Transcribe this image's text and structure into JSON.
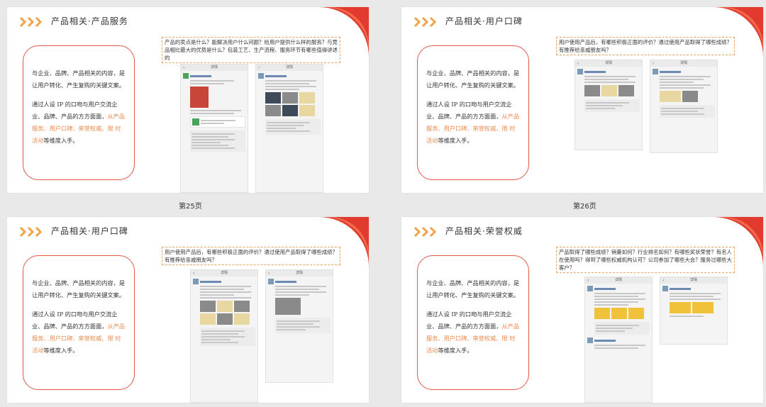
{
  "slides": [
    {
      "title": "产品相关·产品服务",
      "card_p1": "与企业、品牌、产品相关的内容，是让用户转化、产生复购的关键文案。",
      "card_p2_pre": "通过人设 IP 的口吻与用户交流企业、品牌、产品的方方面面，",
      "card_p2_hl": "从产品服务、用户口碑、荣誉权威、限 时活动",
      "card_p2_post": "等维度入手。",
      "question": "产品的卖点是什么？能解决用户什么问题？给用户提供什么样的服务？与竞品相比最大的优势是什么？包装工艺、生产流程、服务环节有哪些值得讲述的",
      "phone_header": "详情"
    },
    {
      "title": "产品相关·用户口碑",
      "card_p1": "与企业、品牌、产品相关的内容，是让用户转化、产生复购的关键文案。",
      "card_p2_pre": "通过人设 IP 的口吻与用户交流企业、品牌、产品的方方面面，",
      "card_p2_hl": "从产品服务、用户口碑、荣誉权威、限 时活动",
      "card_p2_post": "等维度入手。",
      "question": "用户使用产品后，有哪些积极正面的评价？通过使用产品取得了哪些成绩？有推荐给亲戚朋友吗？",
      "phone_header": "详情"
    },
    {
      "title": "产品相关·用户口碑",
      "card_p1": "与企业、品牌、产品相关的内容，是让用户转化、产生复购的关键文案。",
      "card_p2_pre": "通过人设 IP 的口吻与用户交流企业、品牌、产品的方方面面，",
      "card_p2_hl": "从产品服务、用户口碑、荣誉权威、限 时活动",
      "card_p2_post": "等维度入手。",
      "question": "用户使用产品后，有哪些积极正面的评价？通过使用产品取得了哪些成绩？有推荐给亲戚朋友吗？",
      "phone_header": "详情"
    },
    {
      "title": "产品相关·荣誉权威",
      "card_p1": "与企业、品牌、产品相关的内容，是让用户转化、产生复购的关键文案。",
      "card_p2_pre": "通过人设 IP 的口吻与用户交流企业、品牌、产品的方方面面，",
      "card_p2_hl": "从产品服务、用户口碑、荣誉权威、限 时活动",
      "card_p2_post": "等维度入手。",
      "question": "产品取得了哪些成绩？销量如何？行业排名如何？有哪些奖状荣誉？有名人在使用吗？得到了哪些权威机构认可？公司参加了哪些大会？服务过哪些大客户？",
      "phone_header": "详情"
    }
  ],
  "page_labels": [
    "第25页",
    "第26页"
  ],
  "colors": {
    "accent_orange": "#f2a44a",
    "accent_red": "#e23a2f",
    "card_border": "#e4574a",
    "highlight_text": "#f08a4b"
  },
  "icons": [
    "chevrons-icon",
    "back-arrow-icon",
    "corner-decoration"
  ]
}
